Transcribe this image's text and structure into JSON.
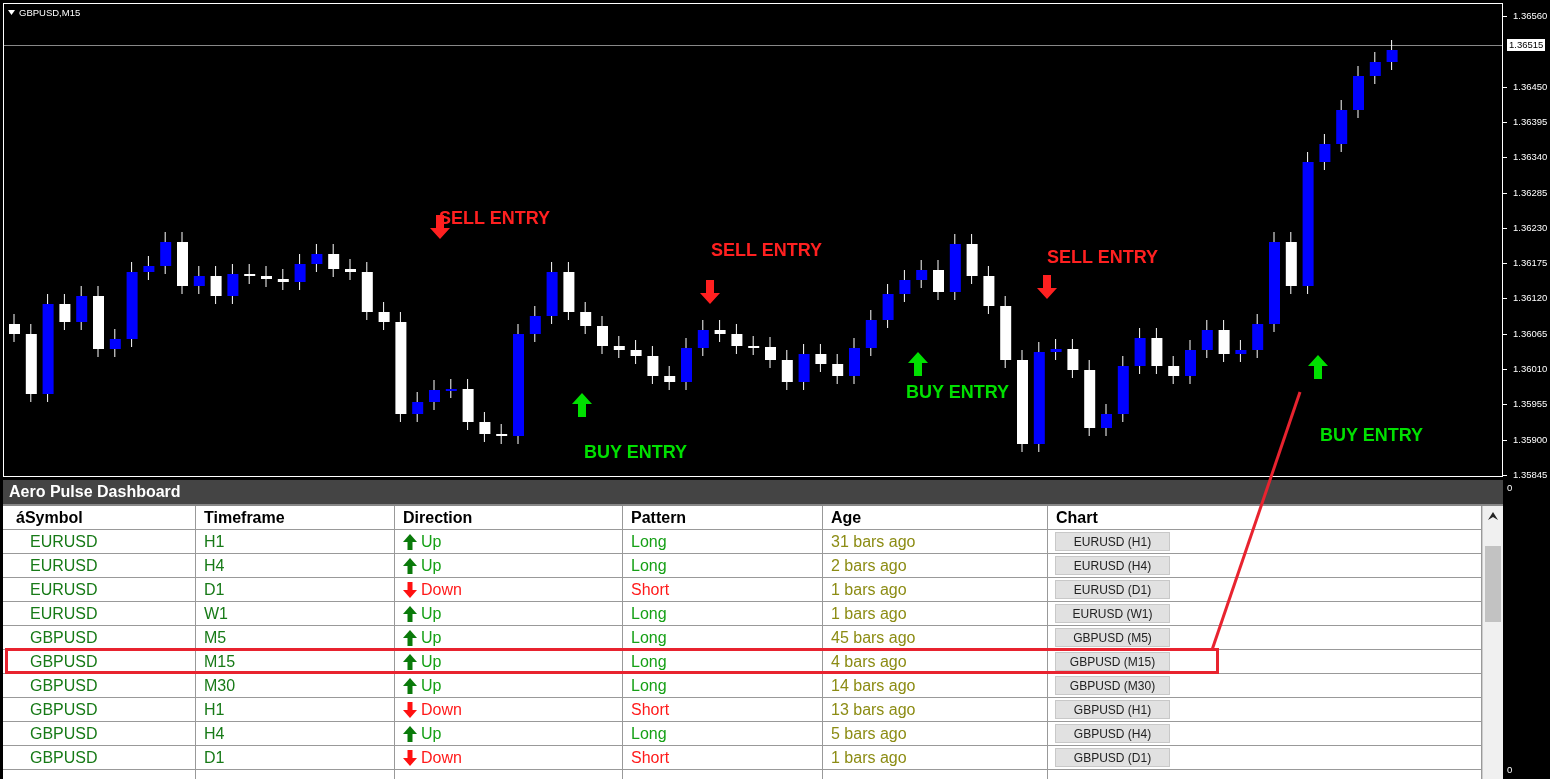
{
  "chart": {
    "title": "GBPUSD,M15",
    "price_labels": [
      "1.36560",
      "1.36450",
      "1.36395",
      "1.36340",
      "1.36285",
      "1.36230",
      "1.36175",
      "1.36120",
      "1.36065",
      "1.36010",
      "1.35955",
      "1.35900",
      "1.35845"
    ],
    "current_price": "1.36515",
    "signals": [
      {
        "kind": "sell",
        "label": "SELL ENTRY"
      },
      {
        "kind": "sell",
        "label": "SELL ENTRY"
      },
      {
        "kind": "sell",
        "label": "SELL ENTRY"
      },
      {
        "kind": "buy",
        "label": "BUY ENTRY"
      },
      {
        "kind": "buy",
        "label": "BUY ENTRY"
      },
      {
        "kind": "buy",
        "label": "BUY ENTRY"
      }
    ]
  },
  "indicator_scale": [
    "0",
    "0"
  ],
  "dashboard": {
    "title": "Aero Pulse Dashboard",
    "columns": [
      "áSymbol",
      "Timeframe",
      "Direction",
      "Pattern",
      "Age",
      "Chart"
    ],
    "rows": [
      {
        "symbol": "EURUSD",
        "timeframe": "H1",
        "direction": "Up",
        "kind": "up",
        "pattern": "Long",
        "age": "31 bars ago",
        "chart": "EURUSD (H1)",
        "highlighted": false
      },
      {
        "symbol": "EURUSD",
        "timeframe": "H4",
        "direction": "Up",
        "kind": "up",
        "pattern": "Long",
        "age": "2 bars ago",
        "chart": "EURUSD (H4)",
        "highlighted": false
      },
      {
        "symbol": "EURUSD",
        "timeframe": "D1",
        "direction": "Down",
        "kind": "down",
        "pattern": "Short",
        "age": "1 bars ago",
        "chart": "EURUSD (D1)",
        "highlighted": false
      },
      {
        "symbol": "EURUSD",
        "timeframe": "W1",
        "direction": "Up",
        "kind": "up",
        "pattern": "Long",
        "age": "1 bars ago",
        "chart": "EURUSD (W1)",
        "highlighted": false
      },
      {
        "symbol": "GBPUSD",
        "timeframe": "M5",
        "direction": "Up",
        "kind": "up",
        "pattern": "Long",
        "age": "45 bars ago",
        "chart": "GBPUSD (M5)",
        "highlighted": false
      },
      {
        "symbol": "GBPUSD",
        "timeframe": "M15",
        "direction": "Up",
        "kind": "up",
        "pattern": "Long",
        "age": "4 bars ago",
        "chart": "GBPUSD (M15)",
        "highlighted": true
      },
      {
        "symbol": "GBPUSD",
        "timeframe": "M30",
        "direction": "Up",
        "kind": "up",
        "pattern": "Long",
        "age": "14 bars ago",
        "chart": "GBPUSD (M30)",
        "highlighted": false
      },
      {
        "symbol": "GBPUSD",
        "timeframe": "H1",
        "direction": "Down",
        "kind": "down",
        "pattern": "Short",
        "age": "13 bars ago",
        "chart": "GBPUSD (H1)",
        "highlighted": false
      },
      {
        "symbol": "GBPUSD",
        "timeframe": "H4",
        "direction": "Up",
        "kind": "up",
        "pattern": "Long",
        "age": "5 bars ago",
        "chart": "GBPUSD (H4)",
        "highlighted": false
      },
      {
        "symbol": "GBPUSD",
        "timeframe": "D1",
        "direction": "Down",
        "kind": "down",
        "pattern": "Short",
        "age": "1 bars ago",
        "chart": "GBPUSD (D1)",
        "highlighted": false
      }
    ]
  }
}
